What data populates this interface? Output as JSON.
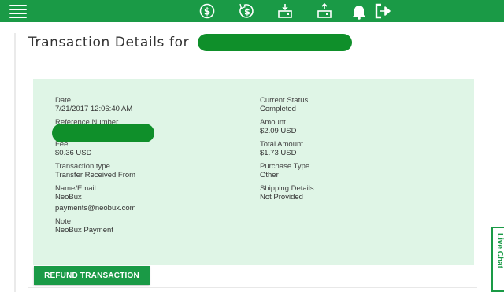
{
  "topbar": {
    "icons": [
      "dollar-circle-icon",
      "dollar-refresh-icon",
      "wallet-in-icon",
      "wallet-out-icon",
      "bell-icon",
      "logout-icon"
    ],
    "accent": "#1a9a46"
  },
  "page": {
    "title": "Transaction Details for"
  },
  "details": {
    "date_label": "Date",
    "date_value": "7/21/2017 12:06:40 AM",
    "reference_label": "Reference Number",
    "fee_label": "Fee",
    "fee_value": "$0.36 USD",
    "transaction_type_label": "Transaction type",
    "transaction_type_value": "Transfer Received From",
    "name_email_label": "Name/Email",
    "name_value": "NeoBux",
    "email_value": "payments@neobux.com",
    "note_label": "Note",
    "note_value": "NeoBux Payment",
    "current_status_label": "Current Status",
    "current_status_value": "Completed",
    "amount_label": "Amount",
    "amount_value": "$2.09 USD",
    "total_amount_label": "Total Amount",
    "total_amount_value": "$1.73 USD",
    "purchase_type_label": "Purchase Type",
    "purchase_type_value": "Other",
    "shipping_label": "Shipping Details",
    "shipping_value": "Not Provided",
    "panel_color": "#dff5e6"
  },
  "actions": {
    "refund_label": "REFUND TRANSACTION"
  },
  "livechat": {
    "label": "Live Chat"
  }
}
